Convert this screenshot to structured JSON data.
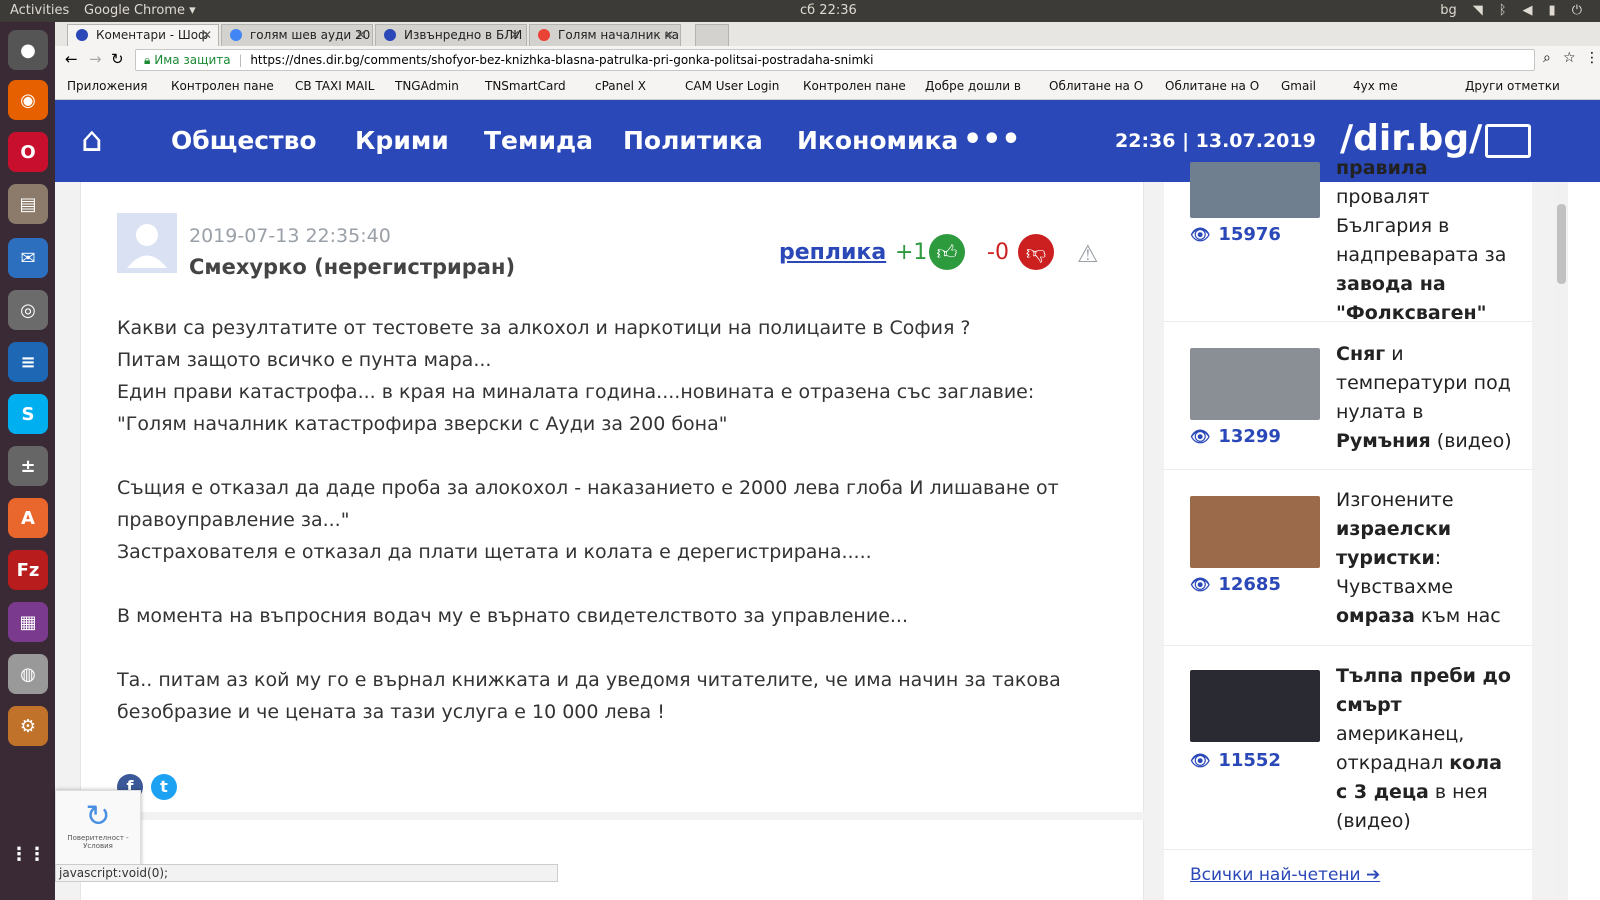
{
  "os": {
    "activities": "Activities",
    "app": "Google Chrome",
    "clock": "сб 22:36",
    "lang": "bg"
  },
  "tabs": [
    {
      "label": "Коментари - Шоф"
    },
    {
      "label": "голям шев ауди 20"
    },
    {
      "label": "Извънредно в БЛИ"
    },
    {
      "label": "Голям началник ка"
    }
  ],
  "address": {
    "secure": "Има защита",
    "url": "https://dnes.dir.bg/comments/shofyor-bez-knizhka-blasna-patrulka-pri-gonka-politsai-postradaha-snimki"
  },
  "bookmarks": [
    "Приложения",
    "Контролен пане",
    "CB TAXI MAIL",
    "TNGAdmin",
    "TNSmartCard",
    "cPanel X",
    "CAM User Login",
    "Контролен пане",
    "Добре дошли в",
    "Облитане на О",
    "Облитане на О",
    "Gmail",
    "4ух me",
    "Други отметки"
  ],
  "nav": {
    "items": [
      "Общество",
      "Крими",
      "Темида",
      "Политика",
      "Икономика"
    ],
    "more": "•••",
    "datetime": "22:36 | 13.07.2019",
    "logo": "/dir.bg/"
  },
  "comment": {
    "timestamp": "2019-07-13 22:35:40",
    "author": "Смехурко (нерегистриран)",
    "reply": "реплика",
    "likes": "+1",
    "dislikes": "-0",
    "lines": [
      "Какви са резултатите от тестовете за алкохол и наркотици на полицаите в София ?",
      "Питам защото всичко е пунта мара...",
      "Един прави катастрофа... в края на миналата година....новината е отразена със заглавие:",
      "\"Голям началник катастрофира зверски с Ауди за 200 бона\"",
      "",
      "Същия е отказал да даде проба за алокохол - наказанието е 2000 лева глоба И лишаване от",
      "правоуправление за...\"",
      "Застрахователя е отказал да плати щетата и колата е дерегистрирана.....",
      "",
      "В момента на въпросния водач му е върнато свидетелството за управление...",
      "",
      "Та.. питам аз кой му го е върнал книжката и да уведомя читателите, че има начин за такова",
      "безобразие и че цената за тази услуга е 10 000 лева !"
    ]
  },
  "status": "javascript:void(0);",
  "captcha": "Поверителност - Условия",
  "sidebar": {
    "articles": [
      {
        "views": "15976",
        "title_html": "<b>правила</b> провалят България в надпреварата за <b>завода на \"Фолксваген\"</b>",
        "color": "#6f7f8f"
      },
      {
        "views": "13299",
        "title_html": "<b>Сняг</b> и температури под нулата в <b>Румъния</b> (видео)",
        "color": "#8a8f96"
      },
      {
        "views": "12685",
        "title_html": "Изгонените <b>израелски туристки</b>: Чувствахме <b>омраза</b> към нас",
        "color": "#9a6a4a"
      },
      {
        "views": "11552",
        "title_html": "<b>Тълпа преби до смърт</b> американец, откраднал <b>кола с 3 деца</b> в нея (видео)",
        "color": "#2a2a33"
      }
    ],
    "more": "Всички най-четени"
  }
}
